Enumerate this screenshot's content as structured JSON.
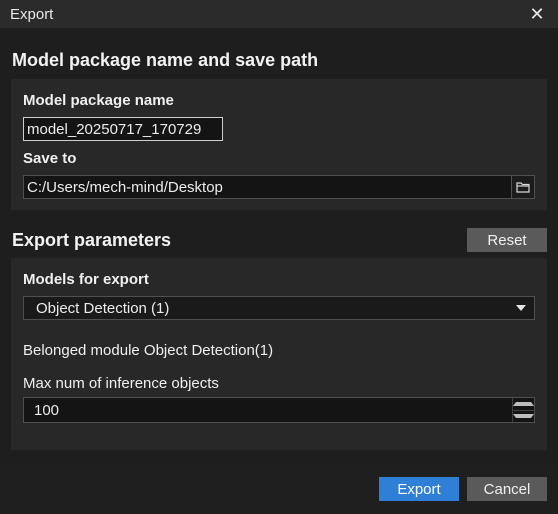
{
  "window": {
    "title": "Export",
    "close_icon": "close-icon"
  },
  "package_section": {
    "title": "Model package name and save path",
    "name_label": "Model package name",
    "name_value": "model_20250717_170729",
    "save_label": "Save to",
    "save_value": "C:/Users/mech-mind/Desktop",
    "folder_icon": "folder-icon"
  },
  "params_section": {
    "title": "Export parameters",
    "reset_label": "Reset",
    "models_label": "Models for export",
    "models_selected": "Object Detection (1)",
    "belonged_text": "Belonged module Object Detection(1)",
    "max_label": "Max num of inference objects",
    "max_value": "100"
  },
  "footer": {
    "export_label": "Export",
    "cancel_label": "Cancel"
  },
  "colors": {
    "accent": "#2f7fd6",
    "panel": "#282828",
    "background": "#1e1e1e"
  }
}
